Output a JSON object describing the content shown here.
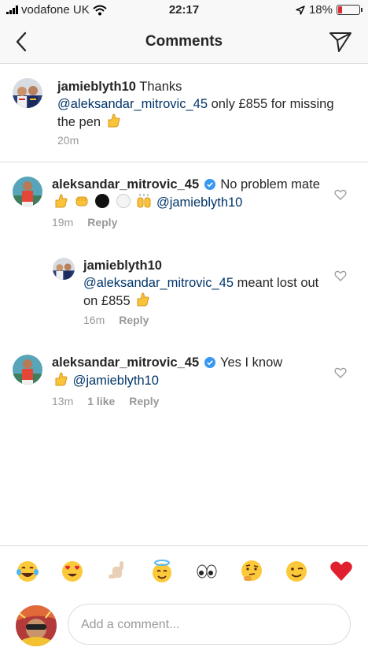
{
  "status_bar": {
    "carrier": "vodafone UK",
    "time": "22:17",
    "battery_percent": "18%",
    "battery_level": 0.18,
    "icons": [
      "signal-icon",
      "wifi-icon",
      "location-arrow-icon",
      "battery-icon"
    ]
  },
  "header": {
    "title": "Comments",
    "back_icon": "chevron-left-icon",
    "send_icon": "paper-plane-icon"
  },
  "caption": {
    "username": "jamieblyth10",
    "text_1": "Thanks",
    "mention": "@aleksandar_mitrovic_45",
    "text_2": "only £855 for missing the pen",
    "emoji": "thumbs-up-emoji",
    "time": "20m"
  },
  "comments": [
    {
      "username": "aleksandar_mitrovic_45",
      "verified": true,
      "text": "No problem mate",
      "emojis": [
        "thumbs-up-emoji",
        "fist-bump-emoji",
        "black-circle-emoji",
        "white-circle-emoji",
        "raising-hands-emoji"
      ],
      "mention": "@jamieblyth10",
      "time": "19m",
      "reply_label": "Reply"
    },
    {
      "username": "jamieblyth10",
      "mention": "@aleksandar_mitrovic_45",
      "text": "meant lost out on £855",
      "emoji": "thumbs-up-emoji",
      "time": "16m",
      "reply_label": "Reply"
    },
    {
      "username": "aleksandar_mitrovic_45",
      "verified": true,
      "text": "Yes I know",
      "emoji": "thumbs-up-emoji",
      "mention": "@jamieblyth10",
      "time": "13m",
      "likes": "1 like",
      "reply_label": "Reply"
    }
  ],
  "emoji_bar": [
    "tears-of-joy-emoji",
    "heart-eyes-emoji",
    "call-me-hand-emoji",
    "halo-emoji",
    "eyes-emoji",
    "thinking-emoji",
    "wink-emoji",
    "red-heart-emoji"
  ],
  "composer": {
    "placeholder": "Add a comment..."
  },
  "colors": {
    "mention": "#003569",
    "meta": "#999999",
    "verified": "#3897f0",
    "divider": "#dbdbdb",
    "battery_low": "#e0282e"
  }
}
